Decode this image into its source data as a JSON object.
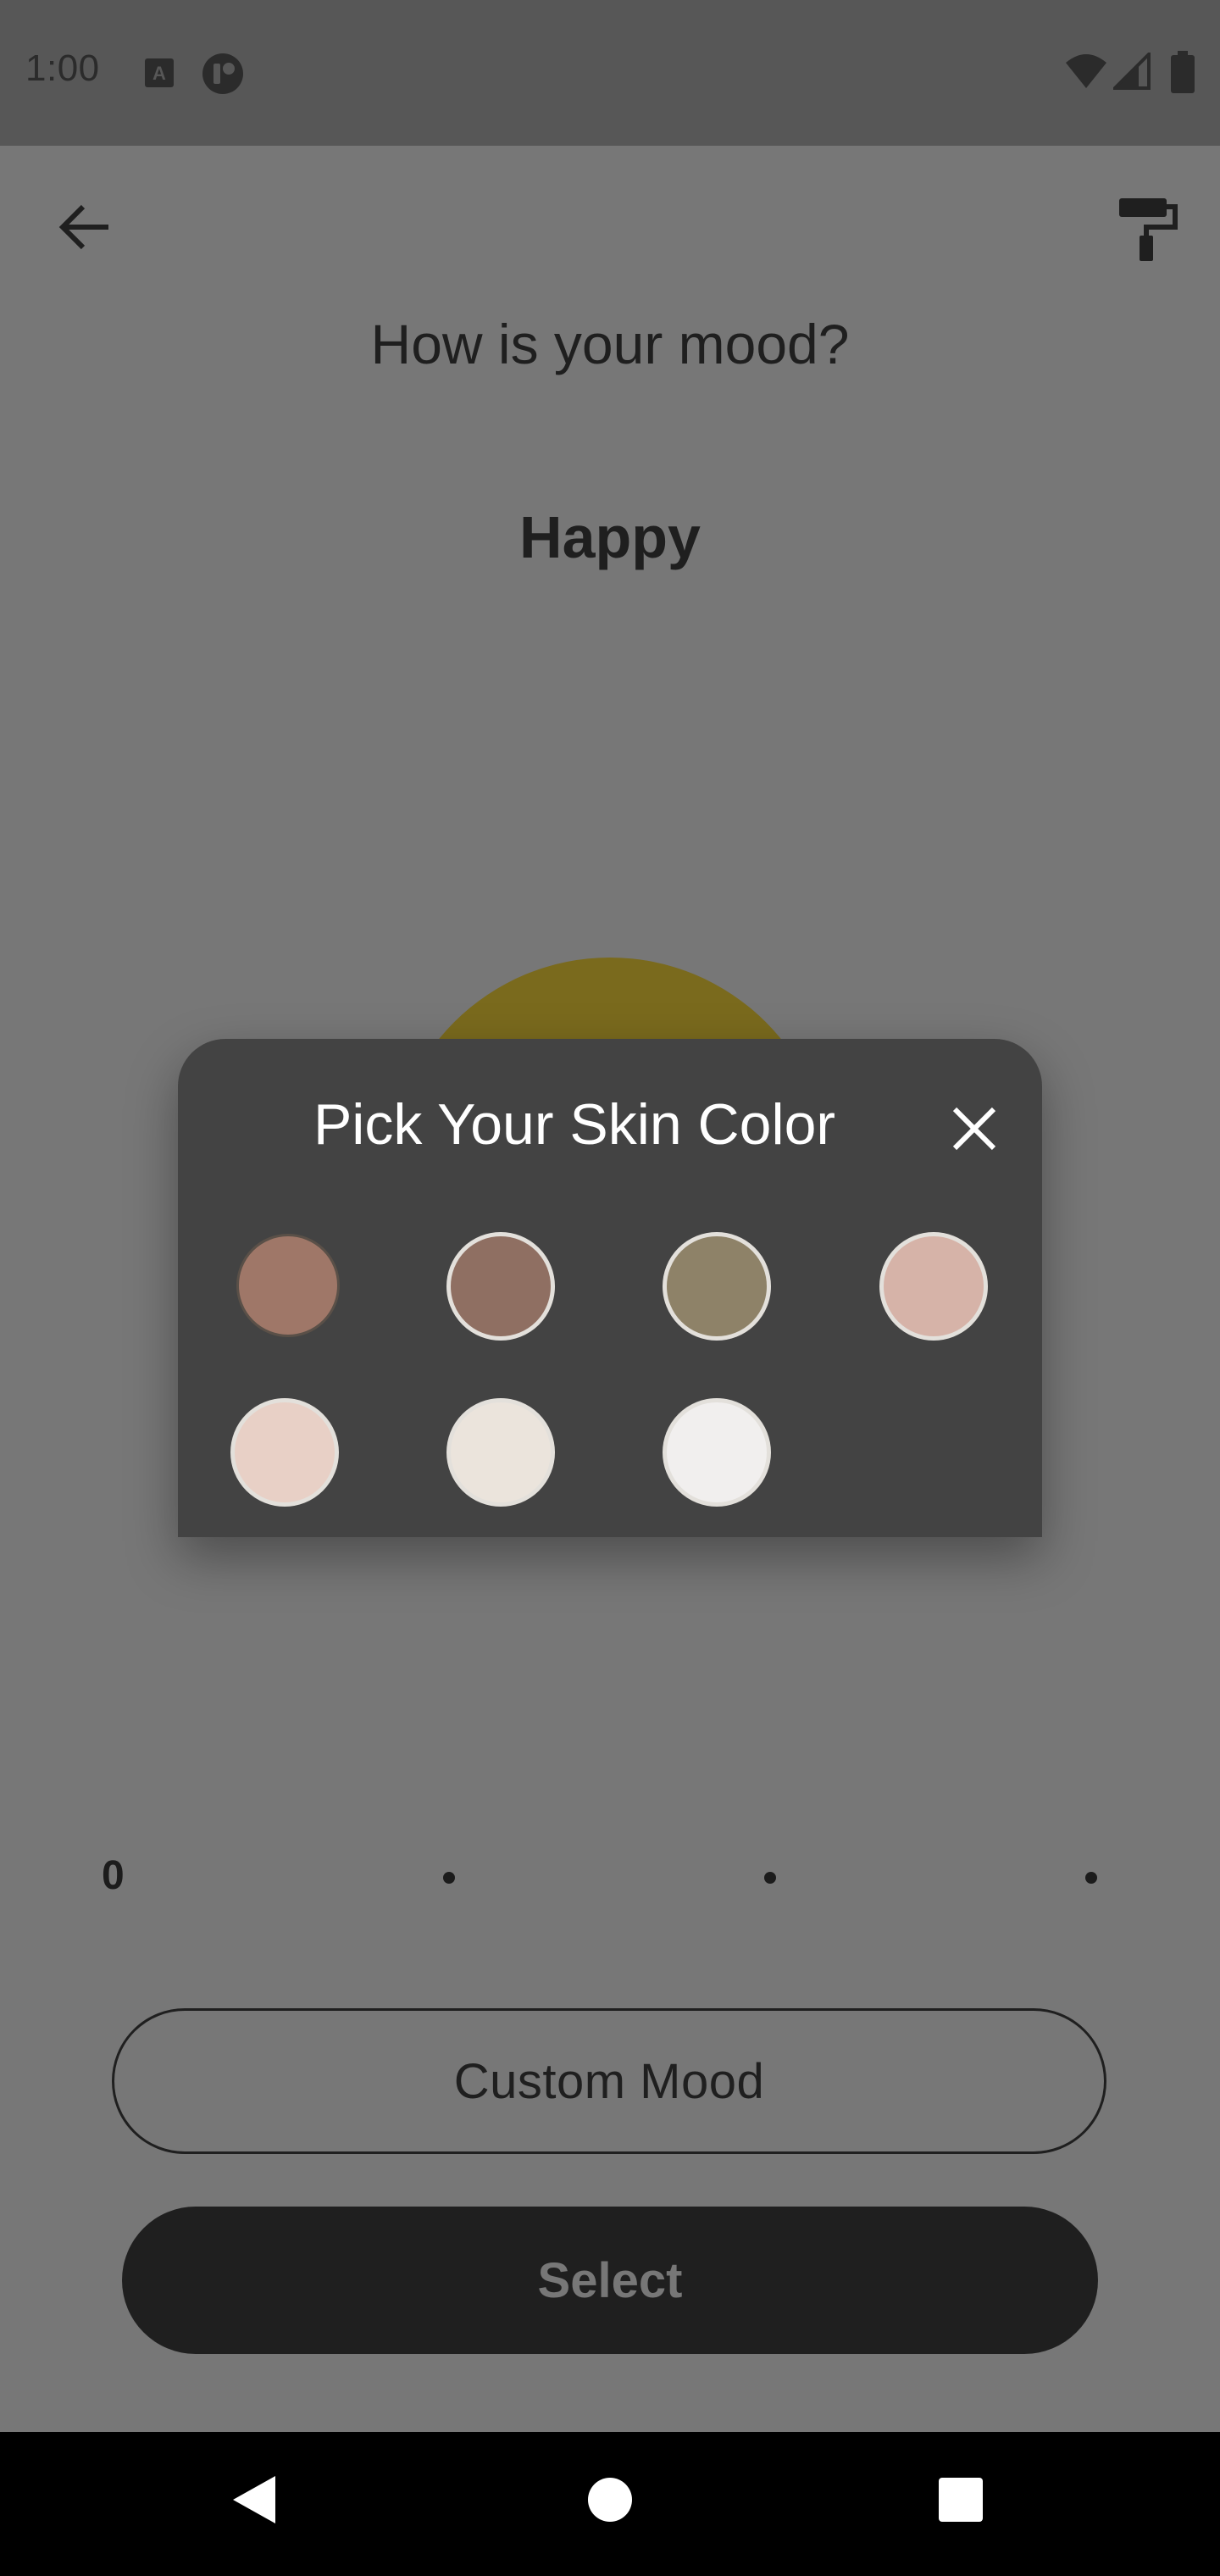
{
  "status_bar": {
    "time": "1:00",
    "icons": [
      "keyboard-a-icon",
      "app-notification-icon",
      "wifi-icon",
      "signal-icon",
      "battery-icon"
    ]
  },
  "top_bar": {
    "back_icon": "arrow-left-icon",
    "theme_icon": "paint-roller-icon"
  },
  "main": {
    "title": "How is your mood?",
    "mood_name": "Happy",
    "slider": {
      "start_label": "0",
      "tick_count": 4,
      "value": 0
    },
    "custom_mood_label": "Custom Mood",
    "select_label": "Select"
  },
  "dialog": {
    "title": "Pick Your Skin Color",
    "close_icon": "close-icon",
    "swatches": [
      {
        "color": "#9f7768",
        "selected": false
      },
      {
        "color": "#8f6f62",
        "selected": false
      },
      {
        "color": "#8e8268",
        "selected": false
      },
      {
        "color": "#d6b3a8",
        "selected": false
      },
      {
        "color": "#e8d0c6",
        "selected": false
      },
      {
        "color": "#ebe4dc",
        "selected": false
      },
      {
        "color": "#f1efee",
        "selected": false
      }
    ]
  },
  "nav_bar": {
    "icons": [
      "back-triangle-icon",
      "home-circle-icon",
      "recents-square-icon"
    ]
  },
  "colors": {
    "scrim_background": "#777777",
    "dialog_background": "#434343",
    "button_dark": "#1f1f1f",
    "emoji_yellow": "#7a6a1d"
  }
}
